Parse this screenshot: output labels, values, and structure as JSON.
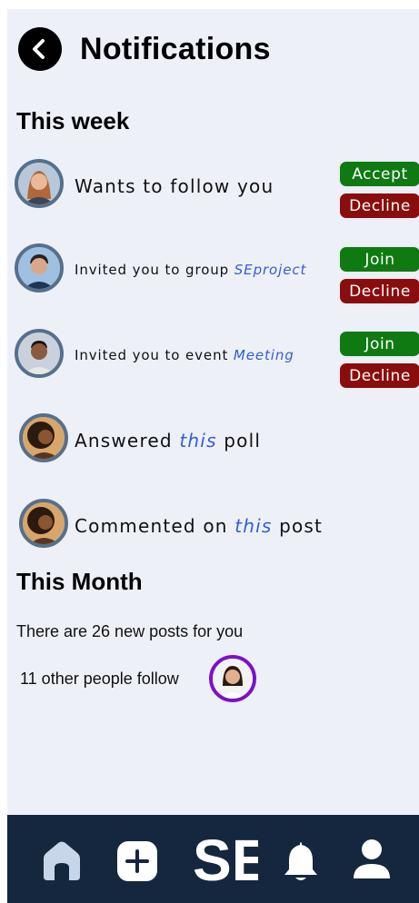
{
  "header": {
    "title": "Notifications",
    "back_icon": "arrow-left-icon"
  },
  "sections": {
    "this_week": "This week",
    "this_month": "This Month"
  },
  "notifications": [
    {
      "text": "Wants to follow you",
      "actions": [
        "Accept",
        "Decline"
      ]
    },
    {
      "prefix": "Invited you to group ",
      "link": "SEproject",
      "actions": [
        "Join",
        "Decline"
      ]
    },
    {
      "prefix": "Invited you to event ",
      "link": "Meeting",
      "actions": [
        "Join",
        "Decline"
      ]
    },
    {
      "prefix": "Answered ",
      "link": "this",
      "suffix": " poll"
    },
    {
      "prefix": "Commented on ",
      "link": "this",
      "suffix": " post"
    }
  ],
  "month": {
    "posts_text": "There are 26 new posts for you",
    "follow_text": "11 other people follow"
  },
  "bottom_nav": {
    "items": [
      "home-icon",
      "add-post-icon",
      "se-logo",
      "bell-icon",
      "profile-icon"
    ],
    "logo_text": "SE"
  },
  "colors": {
    "background": "#eef0f8",
    "accept_green": "#0f7a12",
    "decline_red": "#8a0d0d",
    "link_blue": "#2f5fd8",
    "nav_bg": "#14273f",
    "nav_icon": "#c7d6e8",
    "avatar_ring": "#55708c",
    "follow_ring": "#7b12c9"
  }
}
